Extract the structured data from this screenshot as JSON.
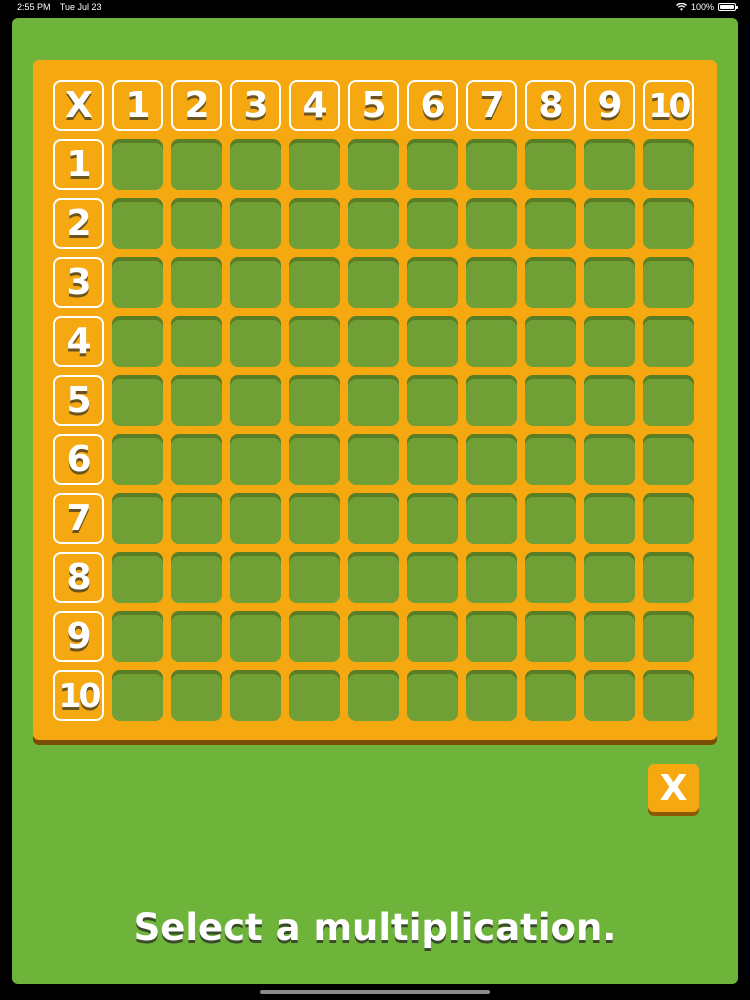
{
  "status_bar": {
    "time": "2:55 PM",
    "date": "Tue Jul 23",
    "battery": "100%"
  },
  "board": {
    "corner_label": "X",
    "column_headers": [
      "1",
      "2",
      "3",
      "4",
      "5",
      "6",
      "7",
      "8",
      "9",
      "10"
    ],
    "row_headers": [
      "1",
      "2",
      "3",
      "4",
      "5",
      "6",
      "7",
      "8",
      "9",
      "10"
    ],
    "rows": 10,
    "columns": 10
  },
  "clear_button_label": "X",
  "prompt": "Select a multiplication.",
  "colors": {
    "background": "#6eb43a",
    "board": "#f5a80f",
    "empty_cell": "#6f9f35"
  },
  "icons": [
    "wifi-icon",
    "battery-icon"
  ]
}
